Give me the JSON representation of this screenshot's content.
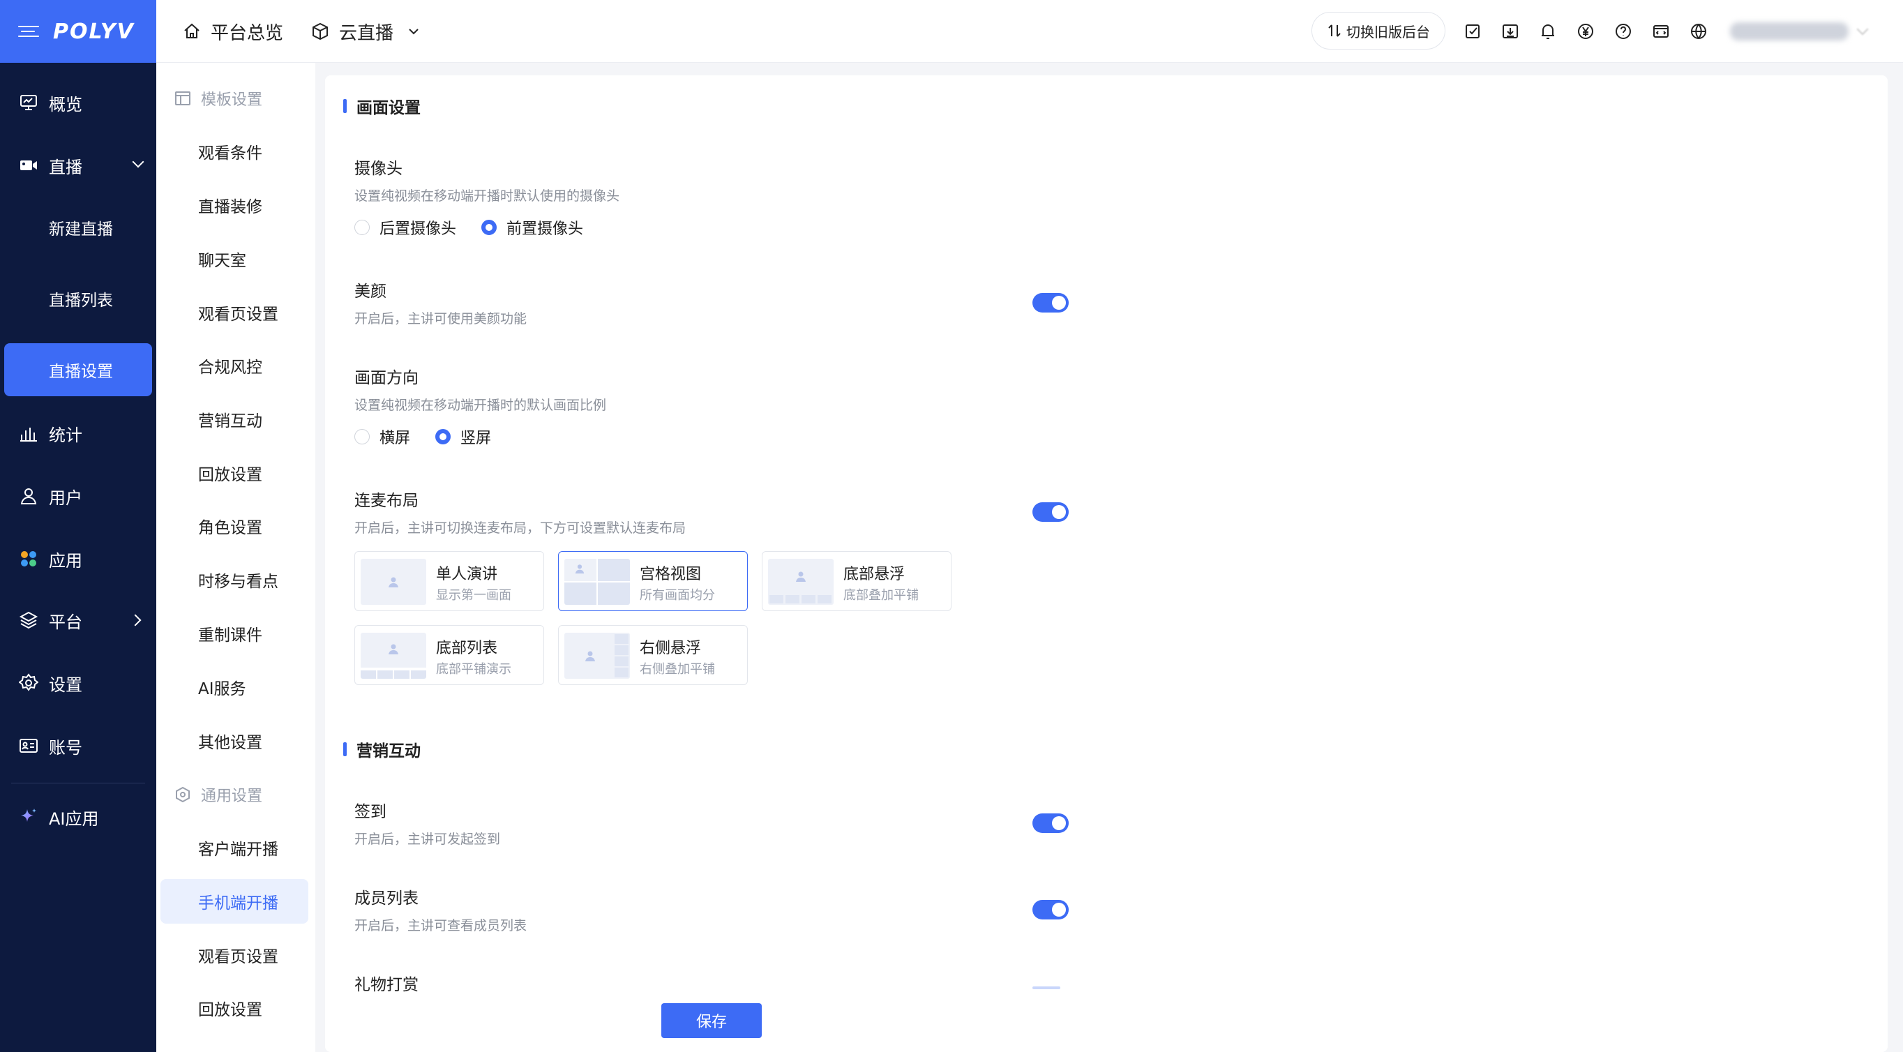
{
  "brand": {
    "logo": "POLYV"
  },
  "nav": {
    "items": [
      {
        "label": "概览",
        "icon": "monitor-chart-icon"
      },
      {
        "label": "直播",
        "icon": "video-camera-icon",
        "expanded": true,
        "children": [
          "新建直播",
          "直播列表",
          "直播设置"
        ],
        "active_child": "直播设置"
      },
      {
        "label": "统计",
        "icon": "bar-chart-icon"
      },
      {
        "label": "用户",
        "icon": "user-icon"
      },
      {
        "label": "应用",
        "icon": "apps-icon"
      },
      {
        "label": "平台",
        "icon": "layers-icon"
      },
      {
        "label": "设置",
        "icon": "gear-icon"
      },
      {
        "label": "账号",
        "icon": "id-card-icon"
      },
      {
        "label": "AI应用",
        "icon": "sparkle-icon"
      }
    ]
  },
  "header": {
    "tabs": [
      {
        "label": "平台总览",
        "icon": "home-icon"
      },
      {
        "label": "云直播",
        "icon": "cube-icon"
      }
    ],
    "switch_label": "切换旧版后台",
    "icons": [
      "edit-note-icon",
      "download-icon",
      "bell-icon",
      "yen-icon",
      "help-icon",
      "code-window-icon",
      "globe-icon"
    ]
  },
  "submenu": {
    "group1": "模板设置",
    "group1_items": [
      "观看条件",
      "直播装修",
      "聊天室",
      "观看页设置",
      "合规风控",
      "营销互动",
      "回放设置",
      "角色设置",
      "时移与看点",
      "重制课件",
      "AI服务",
      "其他设置"
    ],
    "group2": "通用设置",
    "group2_items": [
      "客户端开播",
      "手机端开播",
      "观看页设置",
      "回放设置"
    ],
    "active": "手机端开播"
  },
  "content": {
    "section1": "画面设置",
    "camera": {
      "label": "摄像头",
      "desc": "设置纯视频在移动端开播时默认使用的摄像头",
      "options": [
        "后置摄像头",
        "前置摄像头"
      ],
      "selected": "前置摄像头"
    },
    "beauty": {
      "label": "美颜",
      "desc": "开启后，主讲可使用美颜功能",
      "enabled": true
    },
    "orientation": {
      "label": "画面方向",
      "desc": "设置纯视频在移动端开播时的默认画面比例",
      "options": [
        "横屏",
        "竖屏"
      ],
      "selected": "竖屏"
    },
    "mic_layout": {
      "label": "连麦布局",
      "desc": "开启后，主讲可切换连麦布局，下方可设置默认连麦布局",
      "enabled": true,
      "cards": [
        {
          "title": "单人演讲",
          "desc": "显示第一画面"
        },
        {
          "title": "宫格视图",
          "desc": "所有画面均分"
        },
        {
          "title": "底部悬浮",
          "desc": "底部叠加平铺"
        },
        {
          "title": "底部列表",
          "desc": "底部平铺演示"
        },
        {
          "title": "右侧悬浮",
          "desc": "右侧叠加平铺"
        }
      ],
      "selected": "宫格视图"
    },
    "section2": "营销互动",
    "checkin": {
      "label": "签到",
      "desc": "开启后，主讲可发起签到",
      "enabled": true
    },
    "members": {
      "label": "成员列表",
      "desc": "开启后，主讲可查看成员列表",
      "enabled": true
    },
    "gift": {
      "label": "礼物打赏"
    },
    "save_label": "保存"
  },
  "colors": {
    "primary": "#3d6bf5",
    "nav_bg": "#0d1a3f",
    "page_bg": "#f4f5f8"
  }
}
